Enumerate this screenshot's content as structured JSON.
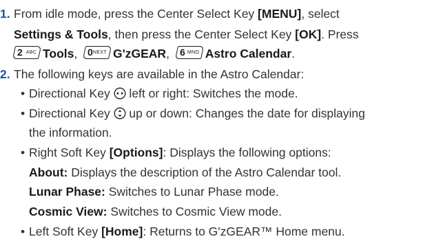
{
  "step1": {
    "number": "1.",
    "line1_pre": "From idle mode, press the Center Select Key ",
    "menu_key": "[MENU]",
    "line1_post": ", select",
    "settings_tools": "Settings & Tools",
    "line2_mid": ", then press the Center Select Key ",
    "ok_key": "[OK]",
    "line2_post": ". Press",
    "key2_main": "2",
    "key2_sub": "ABC",
    "tools": "Tools",
    "comma1": ",",
    "key0_main": "0",
    "key0_sub": "NEXT",
    "gzgear": "G'zGEAR",
    "comma2": ",",
    "key6_main": "6",
    "key6_sub": "MNO",
    "astro_calendar": "Astro Calendar",
    "period": "."
  },
  "step2": {
    "number": "2.",
    "intro": "The following keys are available in the Astro Calendar:",
    "bullets": [
      {
        "pre": "Directional Key ",
        "icon": "left-right-arrows-icon",
        "post": " left or right: Switches the mode."
      },
      {
        "pre": "Directional Key ",
        "icon": "up-down-arrows-icon",
        "post": " up or down: Changes the date for displaying",
        "cont": "the information."
      },
      {
        "pre": "Right Soft Key ",
        "key": "[Options]",
        "post": ": Displays the following options:"
      },
      {
        "pre": "Left Soft Key ",
        "key": "[Home]",
        "post": ": Returns to G'zGEAR™ Home menu."
      }
    ],
    "options": [
      {
        "term": "About:",
        "desc": " Displays the description of the Astro Calendar tool."
      },
      {
        "term": "Lunar Phase:",
        "desc": " Switches to Lunar Phase mode."
      },
      {
        "term": "Cosmic View:",
        "desc": " Switches to Cosmic View mode."
      }
    ]
  },
  "colors": {
    "number": "#1f4e9e",
    "text": "#333333",
    "bold": "#1a1a1a"
  },
  "bullet_char": "•"
}
